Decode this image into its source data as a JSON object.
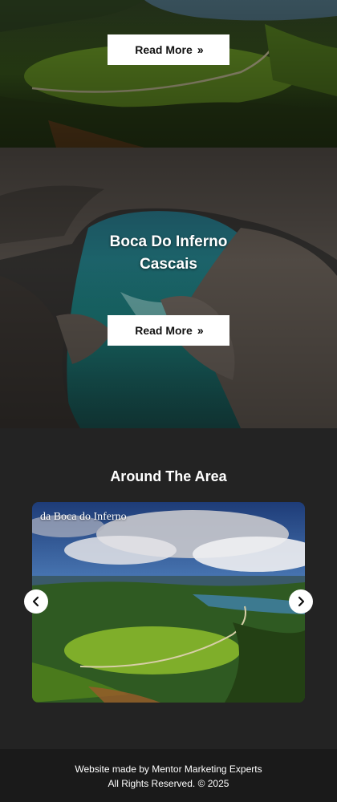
{
  "hero_top": {
    "button_label": "Read More",
    "button_icon": "double-chevron-right-icon"
  },
  "boca": {
    "title_line1": "Boca Do Inferno",
    "title_line2": "Cascais",
    "button_label": "Read More",
    "button_icon": "double-chevron-right-icon"
  },
  "around": {
    "title": "Around The Area",
    "slide_caption": "da Boca do Inferno",
    "prev_icon": "chevron-left-icon",
    "next_icon": "chevron-right-icon"
  },
  "footer": {
    "line1": "Website made by Mentor Marketing Experts",
    "line2": "All Rights Reserved. © 2025"
  },
  "colors": {
    "page_bg": "#232323",
    "footer_bg": "#1a1a1a",
    "button_bg": "#ffffff",
    "button_text": "#111111"
  }
}
